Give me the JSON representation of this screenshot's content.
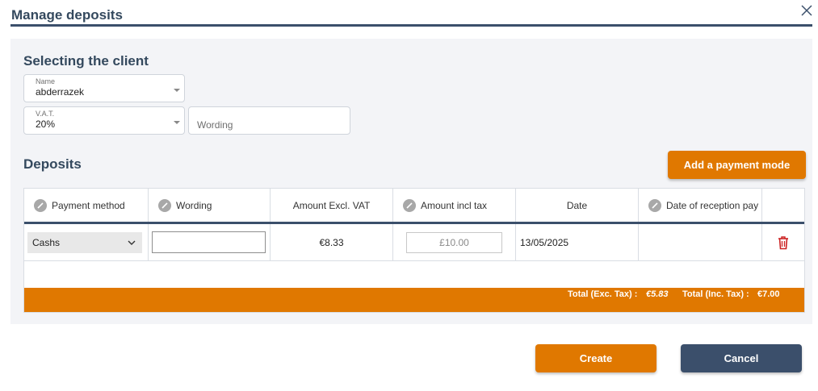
{
  "dialog": {
    "title": "Manage deposits"
  },
  "client": {
    "section_title": "Selecting the client",
    "name_label": "Name",
    "name_value": "abderrazek",
    "vat_label": "V.A.T.",
    "vat_value": "20%",
    "wording_placeholder": "Wording"
  },
  "deposits": {
    "section_title": "Deposits",
    "add_button": "Add a payment mode",
    "columns": [
      "Payment method",
      "Wording",
      "Amount Excl. VAT",
      "Amount incl tax",
      "Date",
      "Date of reception pay"
    ],
    "rows": [
      {
        "payment_method": "Cashs",
        "wording": "",
        "amount_excl": "€8.33",
        "amount_incl": "£10.00",
        "date": "13/05/2025",
        "date_reception": ""
      }
    ],
    "totals": {
      "exc_label": "Total (Exc. Tax) :",
      "exc_value": "€5.83",
      "inc_label": "Total (Inc. Tax) :",
      "inc_value": "€7.00"
    }
  },
  "footer": {
    "create": "Create",
    "cancel": "Cancel"
  },
  "colors": {
    "accent": "#e07800",
    "navy": "#3b4f6b",
    "delete": "#cc2222"
  },
  "icons": [
    "close-icon",
    "pencil-icon",
    "chevron-down-icon",
    "trash-icon"
  ]
}
